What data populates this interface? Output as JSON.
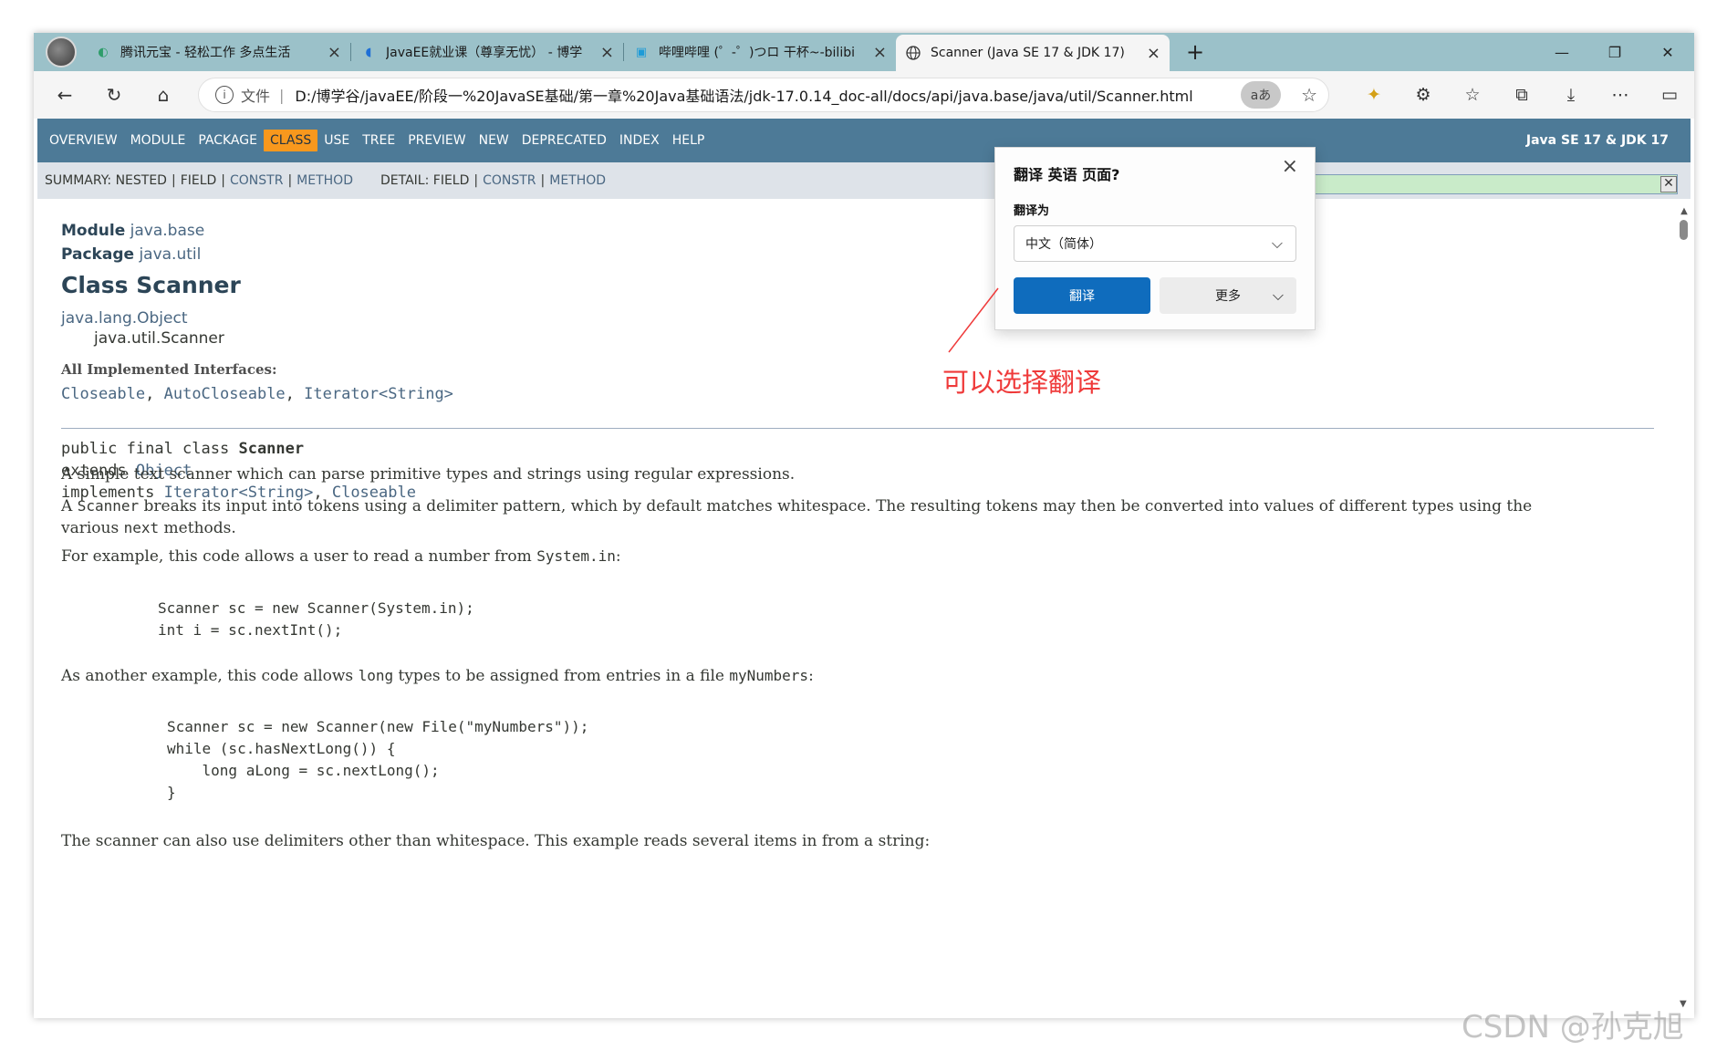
{
  "tabs": [
    {
      "title": "腾讯元宝 - 轻松工作 多点生活",
      "icon": "yuanbao-icon"
    },
    {
      "title": "JavaEE就业课（尊享无忧） - 博学",
      "icon": "bowxue-icon"
    },
    {
      "title": "哔哩哔哩 (゜-゜)つロ 干杯~-bilibi",
      "icon": "bilibili-icon"
    },
    {
      "title": "Scanner (Java SE 17 & JDK 17)",
      "icon": "globe-icon"
    }
  ],
  "address": {
    "file_label": "文件",
    "url": "D:/博学谷/javaEE/阶段一%20JavaSE基础/第一章%20Java基础语法/jdk-17.0.14_doc-all/docs/api/java.base/java/util/Scanner.html",
    "translate_icon": "aあ"
  },
  "nav": {
    "items": [
      "Overview",
      "Module",
      "Package",
      "Class",
      "Use",
      "Tree",
      "Preview",
      "New",
      "Deprecated",
      "Index",
      "Help"
    ],
    "selected": "Class",
    "right_title": "Java SE 17 & JDK 17"
  },
  "subnav": {
    "summary_label": "SUMMARY:",
    "summary": [
      "NESTED",
      "FIELD",
      "CONSTR",
      "METHOD"
    ],
    "detail_label": "DETAIL:",
    "detail": [
      "FIELD",
      "CONSTR",
      "METHOD"
    ]
  },
  "doc": {
    "module_label": "Module",
    "module": "java.base",
    "package_label": "Package",
    "package": "java.util",
    "class_title": "Class Scanner",
    "inherit_root": "java.lang.Object",
    "inherit_child": "java.util.Scanner",
    "ifaces_label": "All Implemented Interfaces:",
    "ifaces": [
      "Closeable",
      "AutoCloseable",
      "Iterator<String>"
    ],
    "decl_line1_a": "public final class ",
    "decl_line1_b": "Scanner",
    "decl_line2_a": "extends ",
    "decl_line2_b": "Object",
    "decl_line3_a": "implements ",
    "decl_line3_b": "Iterator<String>",
    "decl_line3_c": ", ",
    "decl_line3_d": "Closeable",
    "p1": "A simple text scanner which can parse primitive types and strings using regular expressions.",
    "p2_a": "A ",
    "p2_code": "Scanner",
    "p2_b": " breaks its input into tokens using a delimiter pattern, which by default matches whitespace. The resulting tokens may then be converted into values of different types using the",
    "p2_c": "various ",
    "p2_code2": "next",
    "p2_d": " methods.",
    "p3_a": "For example, this code allows a user to read a number from ",
    "p3_code": "System.in",
    "p3_b": ":",
    "code1": "Scanner sc = new Scanner(System.in);\nint i = sc.nextInt();",
    "p4_a": "As another example, this code allows ",
    "p4_code": "long",
    "p4_b": " types to be assigned from entries in a file ",
    "p4_code2": "myNumbers",
    "p4_c": ":",
    "code2": "Scanner sc = new Scanner(new File(\"myNumbers\"));\nwhile (sc.hasNextLong()) {\n    long aLong = sc.nextLong();\n}",
    "p5": "The scanner can also use delimiters other than whitespace. This example reads several items in from a string:"
  },
  "popup": {
    "title": "翻译 英语 页面?",
    "label": "翻译为",
    "selected_language": "中文（简体）",
    "translate_button": "翻译",
    "more_button": "更多"
  },
  "annotation": "可以选择翻译",
  "watermark": "CSDN @孙克旭",
  "colors": {
    "nav_bg": "#4d7a97",
    "nav_selected": "#f8981d",
    "link": "#4a6782",
    "annotation": "#ef3a3a",
    "primary_button": "#0f6cbd"
  }
}
